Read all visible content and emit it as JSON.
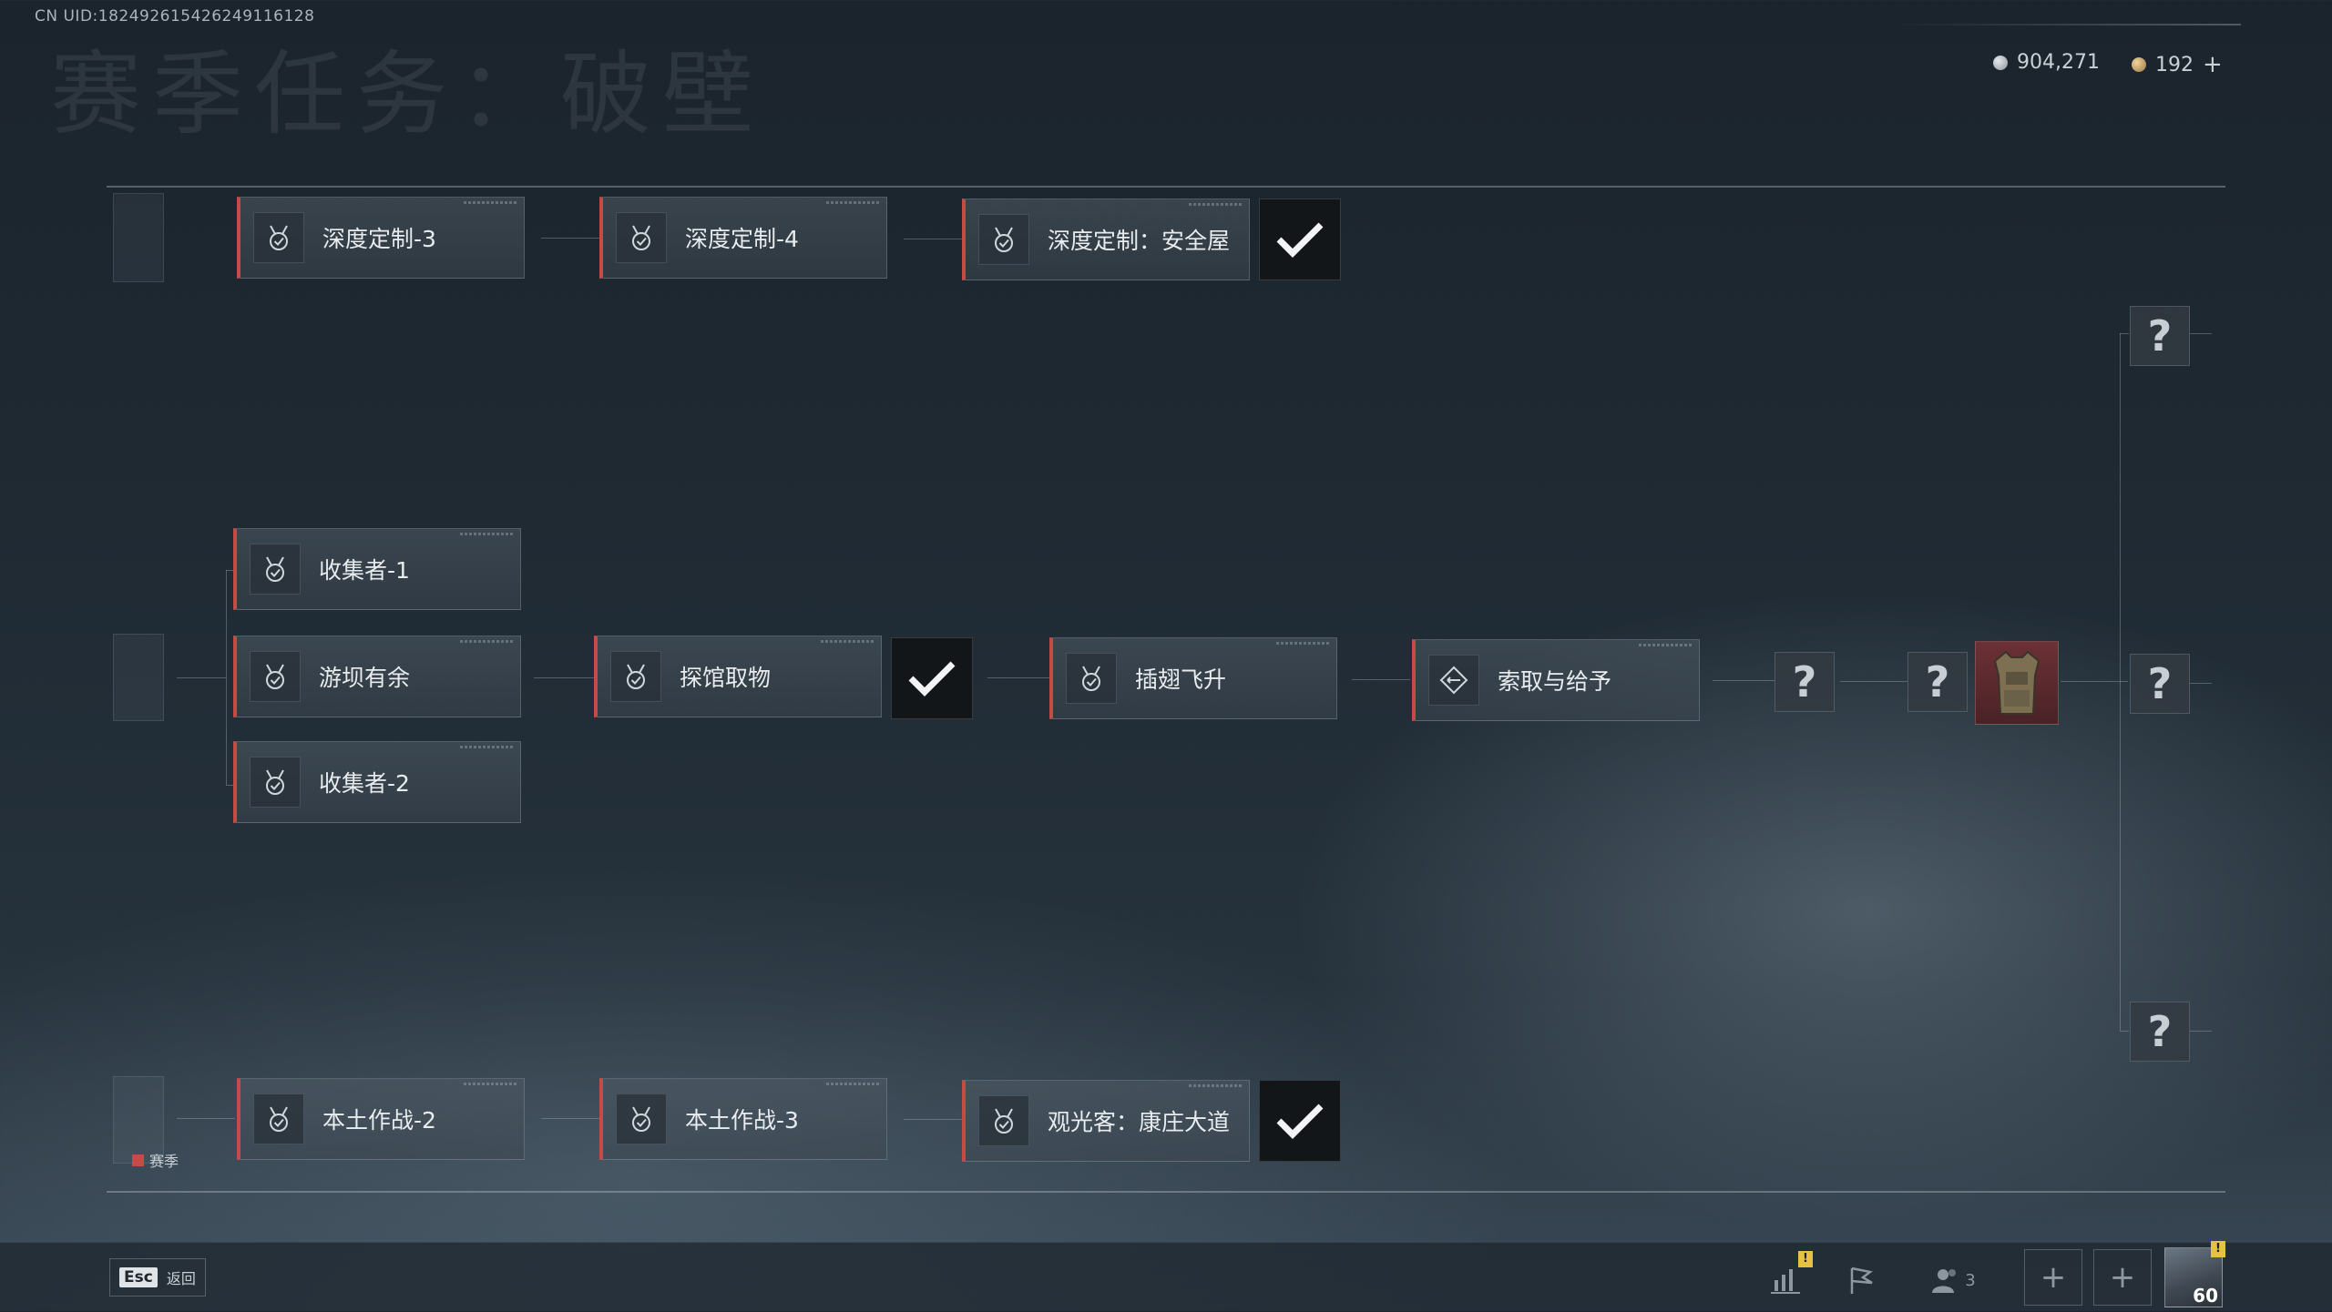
{
  "header": {
    "uid": "CN UID:182492615426249116128",
    "title": "赛季任务：破壁",
    "currency_silver": "904,271",
    "currency_gold": "192",
    "currency_plus": "+"
  },
  "quests": {
    "row_top": [
      "深度定制-3",
      "深度定制-4",
      "深度定制：安全屋"
    ],
    "collector_1": "收集者-1",
    "dam_leisure": "游坝有余",
    "collector_2": "收集者-2",
    "explore": "探馆取物",
    "fly": "插翅飞升",
    "take_give": "索取与给予",
    "row_bottom": [
      "本土作战-2",
      "本土作战-3",
      "观光客：康庄大道"
    ]
  },
  "unknown_symbol": "?",
  "legend": {
    "season_label": "赛季"
  },
  "bottom_bar": {
    "esc_key": "Esc",
    "esc_label": "返回",
    "warn_symbol": "!",
    "friends_count": "3",
    "slot_plus": "+",
    "player_level": "60"
  },
  "colors": {
    "accent_red": "#c64a45",
    "warning_yellow": "#e3c341"
  }
}
